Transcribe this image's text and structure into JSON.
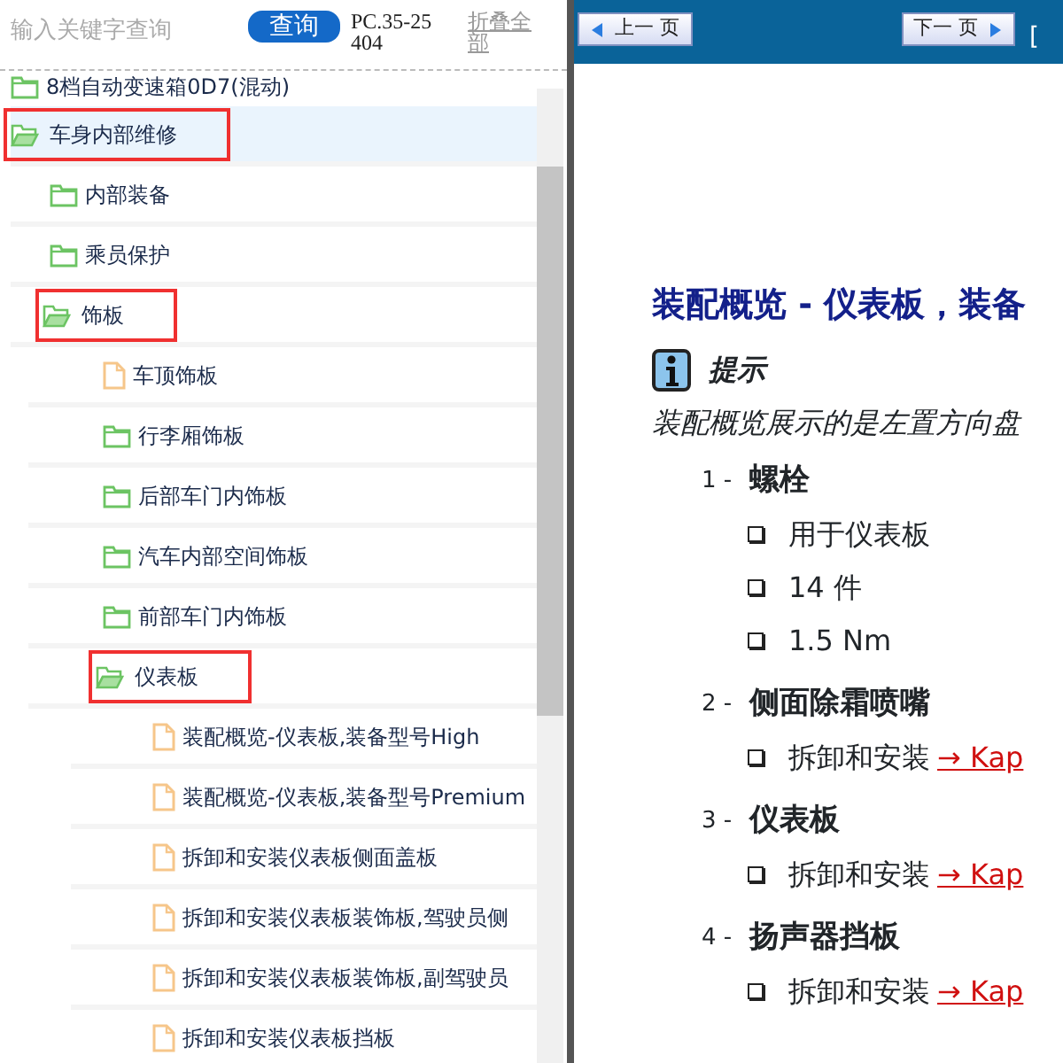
{
  "search": {
    "placeholder": "输入关键字查询",
    "button": "查询",
    "code": "PC.35-25404",
    "collapse_all": "折叠全部"
  },
  "tree": [
    {
      "label": "8档自动变速箱0D7(混动)",
      "kind": "folder",
      "expanded": false,
      "selected": false,
      "highlighted": false
    },
    {
      "label": "车身内部维修",
      "kind": "folder",
      "expanded": true,
      "selected": true,
      "highlighted": true,
      "children": [
        {
          "label": "内部装备",
          "kind": "folder",
          "expanded": false,
          "selected": false,
          "highlighted": false
        },
        {
          "label": "乘员保护",
          "kind": "folder",
          "expanded": false,
          "selected": false,
          "highlighted": false
        },
        {
          "label": "饰板",
          "kind": "folder",
          "expanded": true,
          "selected": false,
          "highlighted": true,
          "children": [
            {
              "label": "车顶饰板",
              "kind": "doc",
              "selected": false,
              "highlighted": false
            },
            {
              "label": "行李厢饰板",
              "kind": "folder",
              "expanded": false,
              "selected": false,
              "highlighted": false
            },
            {
              "label": "后部车门内饰板",
              "kind": "folder",
              "expanded": false,
              "selected": false,
              "highlighted": false
            },
            {
              "label": "汽车内部空间饰板",
              "kind": "folder",
              "expanded": false,
              "selected": false,
              "highlighted": false
            },
            {
              "label": "前部车门内饰板",
              "kind": "folder",
              "expanded": false,
              "selected": false,
              "highlighted": false
            },
            {
              "label": "仪表板",
              "kind": "folder",
              "expanded": true,
              "selected": false,
              "highlighted": true,
              "children": [
                {
                  "label": "装配概览-仪表板,装备型号High",
                  "kind": "doc",
                  "selected": false,
                  "highlighted": false
                },
                {
                  "label": "装配概览-仪表板,装备型号Premium",
                  "kind": "doc",
                  "selected": false,
                  "highlighted": false
                },
                {
                  "label": "拆卸和安装仪表板侧面盖板",
                  "kind": "doc",
                  "selected": false,
                  "highlighted": false
                },
                {
                  "label": "拆卸和安装仪表板装饰板,驾驶员侧",
                  "kind": "doc",
                  "selected": false,
                  "highlighted": false
                },
                {
                  "label": "拆卸和安装仪表板装饰板,副驾驶员",
                  "kind": "doc",
                  "selected": false,
                  "highlighted": false
                },
                {
                  "label": "拆卸和安装仪表板挡板",
                  "kind": "doc",
                  "selected": false,
                  "highlighted": false
                }
              ]
            }
          ]
        }
      ]
    }
  ],
  "doc": {
    "prev": "上一 页",
    "next": "下一 页",
    "header_cut": "[",
    "title": "装配概览 - 仪表板，装备",
    "note_title": "提示",
    "note_text": "装配概览展示的是左置方向盘",
    "items": [
      {
        "number": "1 -",
        "title": "螺栓",
        "bullets": [
          {
            "text": "用于仪表板"
          },
          {
            "text": "14 件"
          },
          {
            "text": "1.5 Nm"
          }
        ]
      },
      {
        "number": "2 -",
        "title": "侧面除霜喷嘴",
        "bullets": [
          {
            "text": "拆卸和安装",
            "link": "→ Kap"
          }
        ]
      },
      {
        "number": "3 -",
        "title": "仪表板",
        "bullets": [
          {
            "text": "拆卸和安装",
            "link": "→ Kap"
          }
        ]
      },
      {
        "number": "4 -",
        "title": "扬声器挡板",
        "bullets": [
          {
            "text": "拆卸和安装",
            "link": "→ Kap"
          }
        ]
      }
    ]
  }
}
